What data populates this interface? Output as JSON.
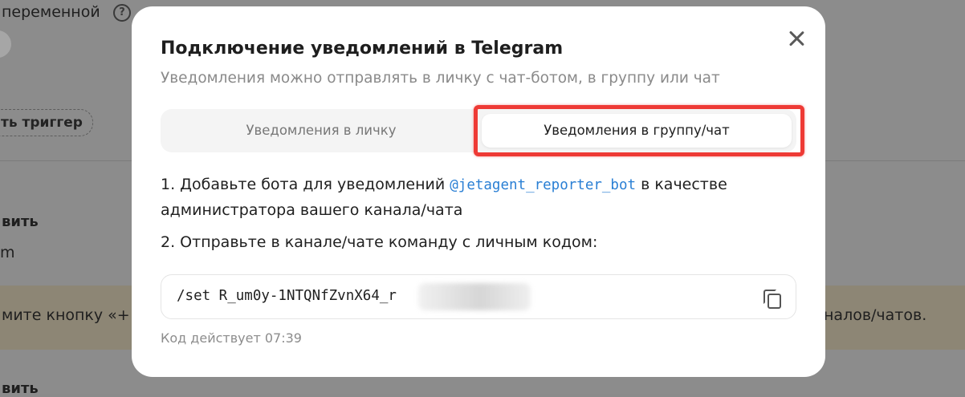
{
  "background": {
    "variable_label": "переменной",
    "help_icon": "?",
    "trigger_button": "ть триггер",
    "section1_label": "вить",
    "section1_sub": "m",
    "banner_left": "мите кнопку «+ Д",
    "banner_right": "налов/чатов.",
    "section2_label": "вить"
  },
  "modal": {
    "title": "Подключение уведомлений в Telegram",
    "subtitle": "Уведомления можно отправлять в личку с чат-ботом, в группу или чат",
    "tabs": [
      {
        "label": "Уведомления в личку",
        "active": false
      },
      {
        "label": "Уведомления в группу/чат",
        "active": true
      }
    ],
    "step1_prefix": "1. Добавьте бота для уведомлений ",
    "step1_bot": "@jetagent_reporter_bot",
    "step1_suffix": " в качестве",
    "step1_line2": "администратора вашего канала/чата",
    "step2": "2. Отправьте в канале/чате команду с личным кодом:",
    "code": "/set R_um0y-1NTQNfZvnX64_r",
    "timer": "Код действует 07:39"
  },
  "colors": {
    "highlight": "#ee3a35",
    "link": "#2a7fd4",
    "overlay": "#8c8c8c"
  },
  "icons": {
    "close": "close-icon",
    "copy": "copy-icon",
    "help": "question-circle-icon"
  }
}
